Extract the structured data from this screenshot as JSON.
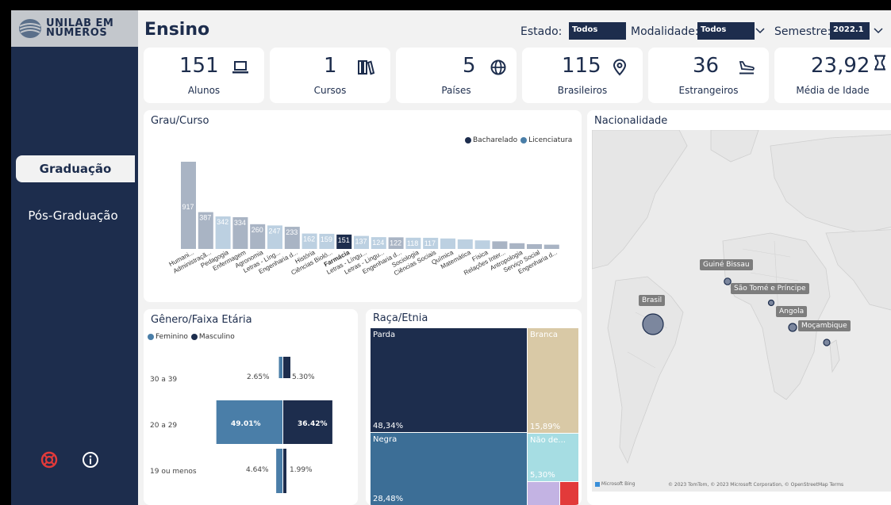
{
  "app": {
    "logo_line1": "UNILAB EM",
    "logo_line2": "NÚMEROS",
    "page_title": "Ensino"
  },
  "sidebar": {
    "items": [
      {
        "label": "Graduação",
        "active": true
      },
      {
        "label": "Pós-Graduação",
        "active": false
      }
    ],
    "help_icon": "lifebuoy-icon",
    "info_icon": "info-icon"
  },
  "filters": {
    "estado": {
      "label": "Estado:",
      "value": "Todos"
    },
    "modalidade": {
      "label": "Modalidade:",
      "value": "Todos"
    },
    "semestre": {
      "label": "Semestre:",
      "value": "2022.1"
    }
  },
  "kpis": [
    {
      "value": "151",
      "label": "Alunos",
      "icon": "laptop-icon"
    },
    {
      "value": "1",
      "label": "Cursos",
      "icon": "books-icon"
    },
    {
      "value": "5",
      "label": "Países",
      "icon": "globe-icon"
    },
    {
      "value": "115",
      "label": "Brasileiros",
      "icon": "map-pin-icon"
    },
    {
      "value": "36",
      "label": "Estrangeiros",
      "icon": "plane-landing-icon"
    },
    {
      "value": "23,92",
      "label": "Média de Idade",
      "icon": "hourglass-icon"
    }
  ],
  "colors": {
    "navy": "#1d2d4d",
    "bacharelado": "#1d2d4d",
    "licenciatura": "#4a7ea8",
    "bar_muted": "#a9b4c4",
    "bar_light": "#bcd0e1",
    "bar_selected": "#1d2d4d",
    "parda": "#1d2d4d",
    "negra": "#3c6e96",
    "branca": "#d9c9a6",
    "nao_declarado": "#a6dde3",
    "amarela": "#c3b3e3",
    "indigena": "#e23a3a",
    "help_red": "#e23a3a"
  },
  "grau_curso": {
    "title": "Grau/Curso",
    "legend": [
      "Bacharelado",
      "Licenciatura"
    ],
    "chart_data": {
      "type": "bar",
      "categories": [
        "Humani...",
        "Administraçã...",
        "Pedagogia",
        "Enfermagem",
        "Agronomia",
        "Letras - Líng...",
        "Engenharia d...",
        "História",
        "Ciências Bioló...",
        "Farmácia",
        "Letras - Língu...",
        "Letras - Lingu...",
        "Engenharia d...",
        "Sociologia",
        "Ciências Sociais",
        "Química",
        "Matemática",
        "Física",
        "Relações Inter...",
        "Antropologia",
        "Serviço Social",
        "Engenharia d..."
      ],
      "values": [
        917,
        387,
        342,
        334,
        260,
        247,
        233,
        162,
        159,
        151,
        137,
        124,
        122,
        118,
        117,
        110,
        100,
        90,
        80,
        60,
        50,
        45
      ],
      "labels": [
        "917",
        "387",
        "342",
        "334",
        "260",
        "247",
        "233",
        "162",
        "159",
        "151",
        "137",
        "124",
        "122",
        "118",
        "117",
        "",
        "",
        "",
        "",
        "",
        "",
        ""
      ],
      "grau": [
        "Bacharelado",
        "Bacharelado",
        "Licenciatura",
        "Bacharelado",
        "Bacharelado",
        "Licenciatura",
        "Bacharelado",
        "Licenciatura",
        "Licenciatura",
        "Bacharelado",
        "Licenciatura",
        "Licenciatura",
        "Bacharelado",
        "Licenciatura",
        "Licenciatura",
        "Licenciatura",
        "Licenciatura",
        "Licenciatura",
        "Bacharelado",
        "Bacharelado",
        "Bacharelado",
        "Bacharelado"
      ],
      "selected": "Farmácia",
      "ylim": [
        0,
        917
      ]
    }
  },
  "genero": {
    "title": "Gênero/Faixa Etária",
    "legend": [
      "Feminino",
      "Masculino"
    ],
    "chart_data": {
      "type": "bar",
      "categories": [
        "30 a 39",
        "20 a 29",
        "19 ou menos"
      ],
      "series": [
        {
          "name": "Feminino",
          "values": [
            2.65,
            49.01,
            4.64
          ],
          "labels": [
            "2.65%",
            "49.01%",
            "4.64%"
          ]
        },
        {
          "name": "Masculino",
          "values": [
            5.3,
            36.42,
            1.99
          ],
          "labels": [
            "5.30%",
            "36.42%",
            "1.99%"
          ]
        }
      ]
    }
  },
  "raca": {
    "title": "Raça/Etnia",
    "chart_data": {
      "type": "treemap",
      "cells": [
        {
          "name": "Parda",
          "value": 48.34,
          "label": "48,34%"
        },
        {
          "name": "Negra",
          "value": 28.48,
          "label": "28,48%"
        },
        {
          "name": "Branca",
          "value": 15.89,
          "label": "15,89%"
        },
        {
          "name": "Não de...",
          "value": 5.3,
          "label": "5,30%"
        },
        {
          "name": "",
          "value": 1.33,
          "label": ""
        },
        {
          "name": "",
          "value": 0.66,
          "label": ""
        }
      ]
    }
  },
  "nacionalidade": {
    "title": "Nacionalidade",
    "points": [
      {
        "name": "Brasil",
        "value": 115
      },
      {
        "name": "Guiné Bissau",
        "value": 0
      },
      {
        "name": "São Tomé e Príncipe",
        "value": 0
      },
      {
        "name": "Angola",
        "value": 0
      },
      {
        "name": "Moçambique",
        "value": 0
      }
    ],
    "credit": "© 2023 TomTom, © 2023 Microsoft Corporation, © OpenStreetMap  Terms",
    "bing": "Microsoft Bing"
  }
}
